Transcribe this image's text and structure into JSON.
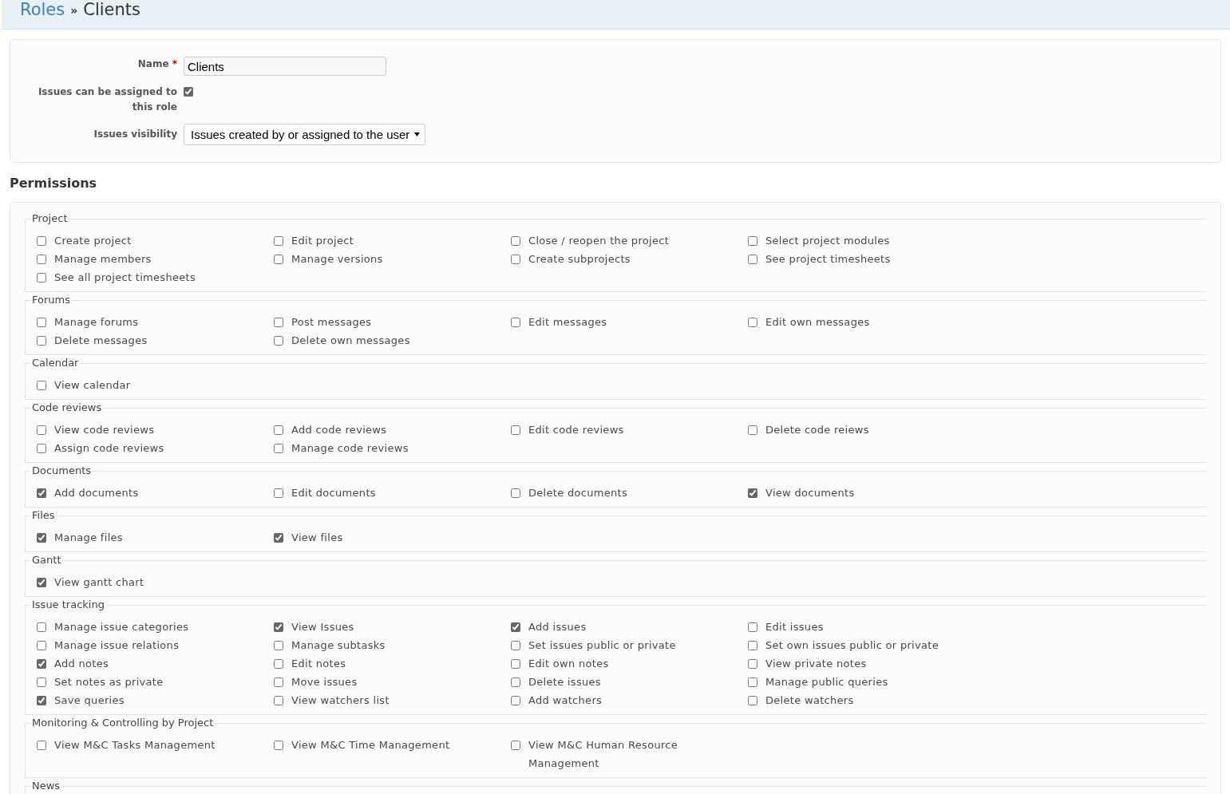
{
  "breadcrumb": {
    "parent": "Roles",
    "separator": "»",
    "current": "Clients"
  },
  "form": {
    "name": {
      "label": "Name",
      "required_mark": "*",
      "value": "Clients"
    },
    "assignable": {
      "label": "Issues can be assigned to this role",
      "checked": true
    },
    "visibility": {
      "label": "Issues visibility",
      "value": "Issues created by or assigned to the user"
    }
  },
  "permissions": {
    "heading": "Permissions",
    "groups": [
      {
        "legend": "Project",
        "items": [
          {
            "label": "Create project",
            "checked": false
          },
          {
            "label": "Edit project",
            "checked": false
          },
          {
            "label": "Close / reopen the project",
            "checked": false
          },
          {
            "label": "Select project modules",
            "checked": false
          },
          {
            "label": "Manage members",
            "checked": false
          },
          {
            "label": "Manage versions",
            "checked": false
          },
          {
            "label": "Create subprojects",
            "checked": false
          },
          {
            "label": "See project timesheets",
            "checked": false
          },
          {
            "label": "See all project timesheets",
            "checked": false
          }
        ]
      },
      {
        "legend": "Forums",
        "items": [
          {
            "label": "Manage forums",
            "checked": false
          },
          {
            "label": "Post messages",
            "checked": false
          },
          {
            "label": "Edit messages",
            "checked": false
          },
          {
            "label": "Edit own messages",
            "checked": false
          },
          {
            "label": "Delete messages",
            "checked": false
          },
          {
            "label": "Delete own messages",
            "checked": false
          }
        ]
      },
      {
        "legend": "Calendar",
        "items": [
          {
            "label": "View calendar",
            "checked": false
          }
        ]
      },
      {
        "legend": "Code reviews",
        "items": [
          {
            "label": "View code reviews",
            "checked": false
          },
          {
            "label": "Add code reviews",
            "checked": false
          },
          {
            "label": "Edit code reviews",
            "checked": false
          },
          {
            "label": "Delete code reiews",
            "checked": false
          },
          {
            "label": "Assign code reviews",
            "checked": false
          },
          {
            "label": "Manage code reviews",
            "checked": false
          }
        ]
      },
      {
        "legend": "Documents",
        "items": [
          {
            "label": "Add documents",
            "checked": true
          },
          {
            "label": "Edit documents",
            "checked": false
          },
          {
            "label": "Delete documents",
            "checked": false
          },
          {
            "label": "View documents",
            "checked": true
          }
        ]
      },
      {
        "legend": "Files",
        "items": [
          {
            "label": "Manage files",
            "checked": true
          },
          {
            "label": "View files",
            "checked": true
          }
        ]
      },
      {
        "legend": "Gantt",
        "items": [
          {
            "label": "View gantt chart",
            "checked": true
          }
        ]
      },
      {
        "legend": "Issue tracking",
        "items": [
          {
            "label": "Manage issue categories",
            "checked": false
          },
          {
            "label": "View Issues",
            "checked": true
          },
          {
            "label": "Add issues",
            "checked": true
          },
          {
            "label": "Edit issues",
            "checked": false
          },
          {
            "label": "Manage issue relations",
            "checked": false
          },
          {
            "label": "Manage subtasks",
            "checked": false
          },
          {
            "label": "Set issues public or private",
            "checked": false
          },
          {
            "label": "Set own issues public or private",
            "checked": false
          },
          {
            "label": "Add notes",
            "checked": true
          },
          {
            "label": "Edit notes",
            "checked": false
          },
          {
            "label": "Edit own notes",
            "checked": false
          },
          {
            "label": "View private notes",
            "checked": false
          },
          {
            "label": "Set notes as private",
            "checked": false
          },
          {
            "label": "Move issues",
            "checked": false
          },
          {
            "label": "Delete issues",
            "checked": false
          },
          {
            "label": "Manage public queries",
            "checked": false
          },
          {
            "label": "Save queries",
            "checked": true
          },
          {
            "label": "View watchers list",
            "checked": false
          },
          {
            "label": "Add watchers",
            "checked": false
          },
          {
            "label": "Delete watchers",
            "checked": false
          }
        ]
      },
      {
        "legend": "Monitoring & Controlling by Project",
        "items": [
          {
            "label": "View M&C Tasks Management",
            "checked": false
          },
          {
            "label": "View M&C Time Management",
            "checked": false
          },
          {
            "label": "View M&C Human Resource Management",
            "checked": false
          }
        ]
      },
      {
        "legend": "News"
      }
    ]
  }
}
